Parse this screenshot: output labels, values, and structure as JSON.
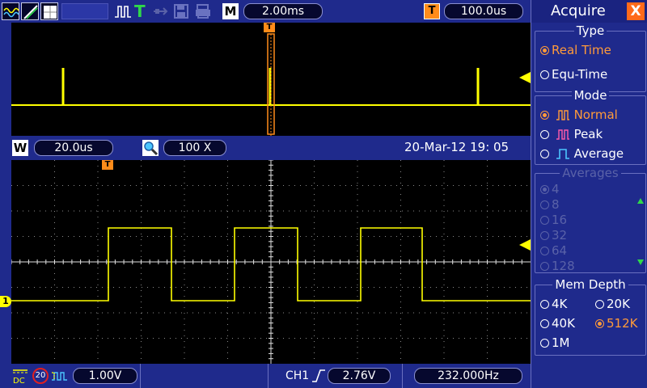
{
  "topbar": {
    "mode_letter": "M",
    "timebase": "2.00ms",
    "trigger_letter": "T",
    "trigger_position": "100.0us"
  },
  "midbar": {
    "window_letter": "W",
    "window_timebase": "20.0us",
    "zoom": "100 X",
    "datetime": "20-Mar-12 19: 05"
  },
  "bottombar": {
    "coupling": "DC",
    "bw_limit": "20",
    "ch1_scale": "1.00V",
    "trigger_source": "CH1",
    "trigger_level": "2.76V",
    "frequency": "232.000Hz"
  },
  "markers": {
    "trigger_marker": "T",
    "channel_marker": "1"
  },
  "menu": {
    "title": "Acquire",
    "close": "X",
    "type": {
      "title": "Type",
      "options": [
        "Real Time",
        "Equ-Time"
      ],
      "selected": 0
    },
    "mode": {
      "title": "Mode",
      "options": [
        "Normal",
        "Peak",
        "Average"
      ],
      "selected": 0
    },
    "averages": {
      "title": "Averages",
      "options": [
        "4",
        "8",
        "16",
        "32",
        "64",
        "128"
      ],
      "selected": 0
    },
    "mem_depth": {
      "title": "Mem Depth",
      "options": [
        "4K",
        "20K",
        "40K",
        "512K",
        "1M"
      ],
      "selected": 3
    }
  },
  "colors": {
    "trace": "#ffff00",
    "accent": "#ff9a3a",
    "panel": "#1f2a8c",
    "screen": "#000000"
  }
}
